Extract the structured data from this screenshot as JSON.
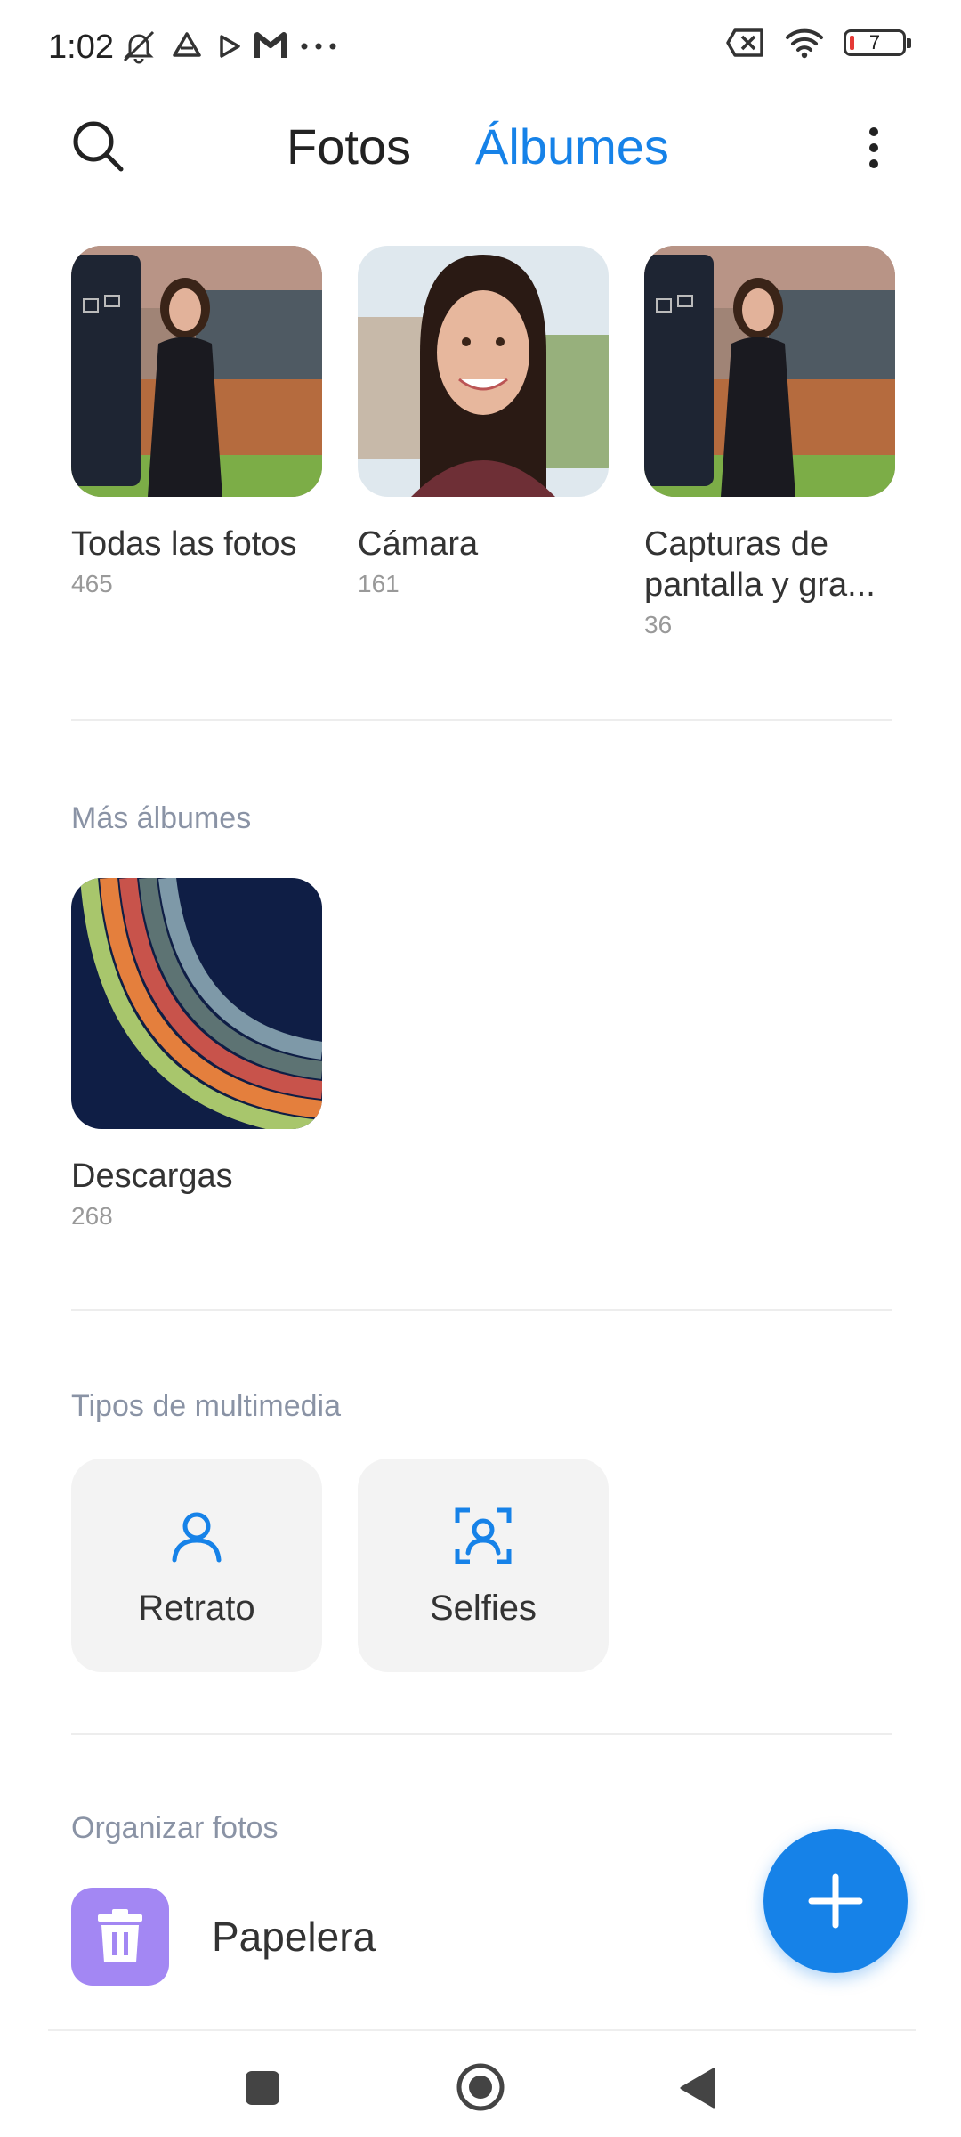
{
  "status_bar": {
    "time": "1:02",
    "battery_level": "7",
    "icons": [
      "mute-bell-icon",
      "drive-icon",
      "play-icon",
      "m-icon",
      "more-dots-icon",
      "no-sim-icon",
      "wifi-icon",
      "battery-icon"
    ]
  },
  "header": {
    "tabs": [
      {
        "label": "Fotos",
        "active": false
      },
      {
        "label": "Álbumes",
        "active": true
      }
    ],
    "accent_color": "#1682e8"
  },
  "albums": [
    {
      "name": "Todas las fotos",
      "count": "465"
    },
    {
      "name": "Cámara",
      "count": "161"
    },
    {
      "name": "Capturas de pantalla y gra...",
      "count": "36"
    }
  ],
  "more_albums": {
    "title": "Más álbumes",
    "items": [
      {
        "name": "Descargas",
        "count": "268"
      }
    ]
  },
  "media_types": {
    "title": "Tipos de multimedia",
    "items": [
      {
        "label": "Retrato",
        "icon": "portrait-icon"
      },
      {
        "label": "Selfies",
        "icon": "selfie-icon"
      }
    ]
  },
  "organize": {
    "title": "Organizar fotos",
    "items": [
      {
        "label": "Papelera",
        "icon": "trash-icon"
      }
    ]
  },
  "fab": {
    "icon": "plus-icon"
  },
  "nav": {
    "icons": [
      "recents-icon",
      "home-icon",
      "back-icon"
    ]
  }
}
